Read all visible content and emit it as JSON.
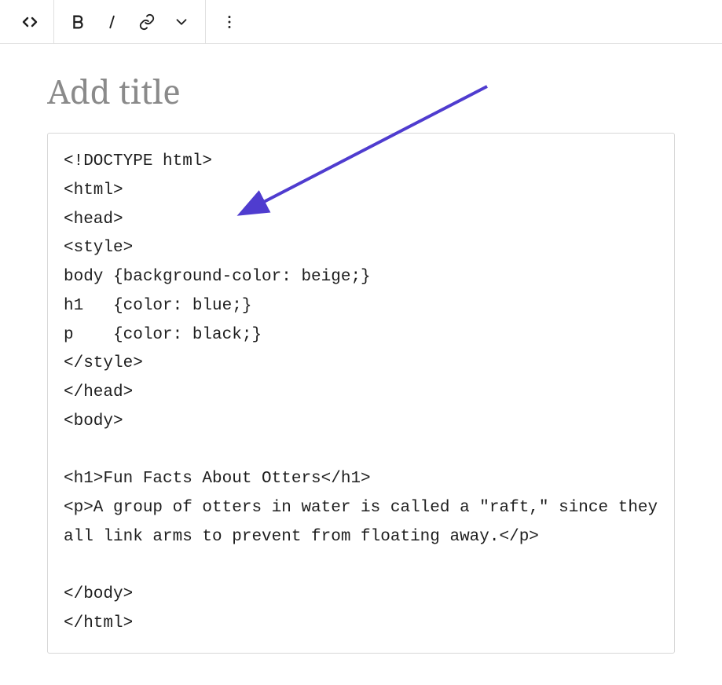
{
  "toolbar": {
    "code_btn": "code-toggle",
    "bold_btn": "bold",
    "italic_btn": "italic",
    "link_btn": "link",
    "more_format_btn": "more-formatting",
    "options_btn": "options"
  },
  "title": {
    "placeholder": "Add title",
    "value": ""
  },
  "code_block": {
    "content": "<!DOCTYPE html>\n<html>\n<head>\n<style>\nbody {background-color: beige;}\nh1   {color: blue;}\np    {color: black;}\n</style>\n</head>\n<body>\n\n<h1>Fun Facts About Otters</h1>\n<p>A group of otters in water is called a \"raft,\" since they all link arms to prevent from floating away.</p>\n\n</body>\n</html>"
  },
  "annotation": {
    "type": "arrow",
    "color": "#4f3ccf"
  }
}
